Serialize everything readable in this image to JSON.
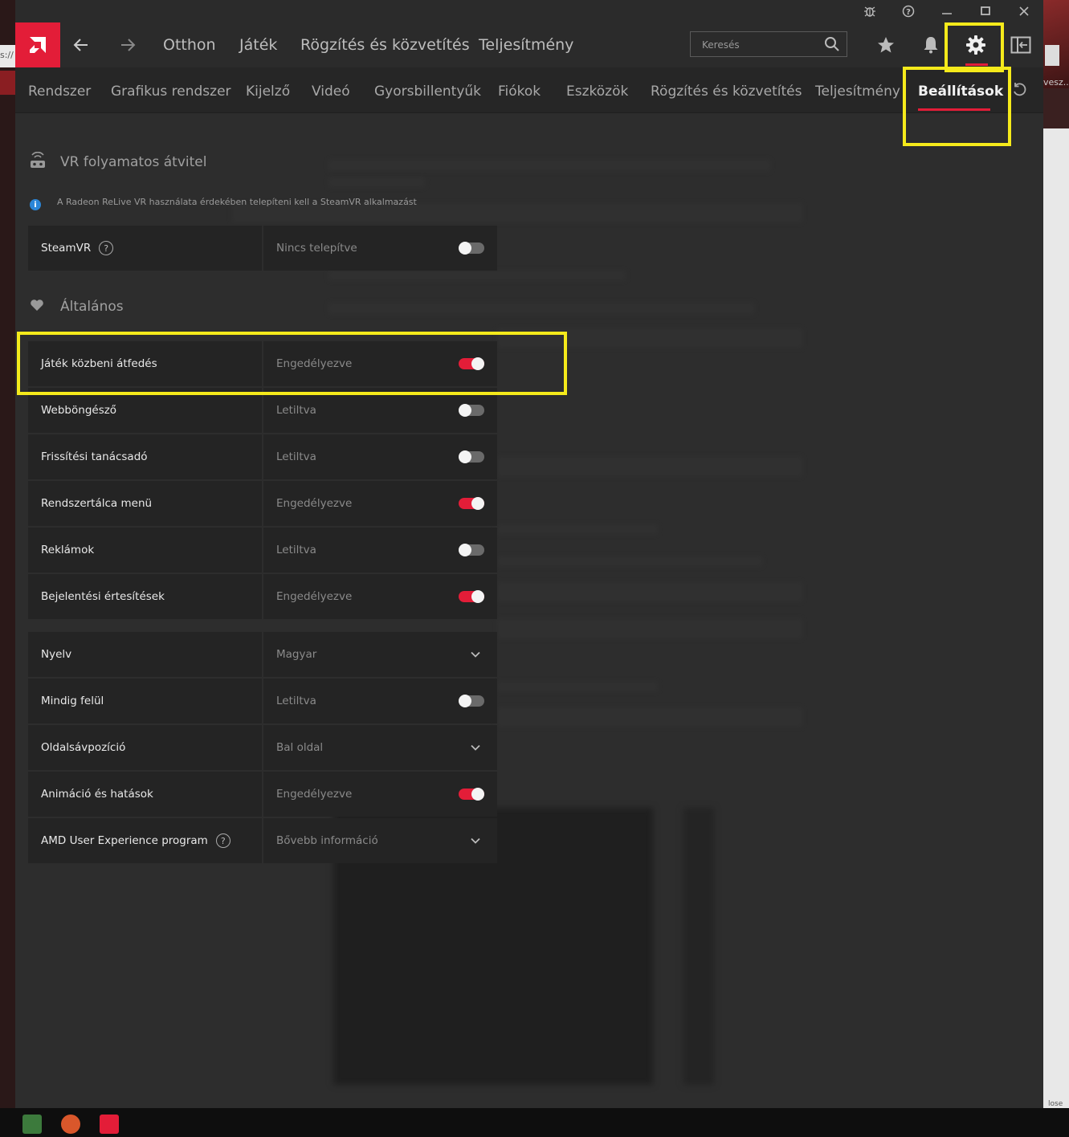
{
  "window": {
    "controls": {
      "bug": "bug-icon",
      "help": "help-icon",
      "minimize": "minimize-icon",
      "maximize": "maximize-icon",
      "close": "close-icon"
    }
  },
  "nav": {
    "back_icon": "back-arrow-icon",
    "forward_icon": "forward-arrow-icon",
    "links": [
      "Otthon",
      "Játék",
      "Rögzítés és közvetítés",
      "Teljesítmény"
    ],
    "search_placeholder": "Keresés"
  },
  "subnav": {
    "tabs": [
      "Rendszer",
      "Grafikus rendszer",
      "Kijelző",
      "Videó",
      "Gyorsbillentyűk",
      "Fiókok",
      "Eszközök",
      "Rögzítés és közvetítés",
      "Teljesítmény",
      "Beállítások"
    ],
    "active_index": 9
  },
  "vr": {
    "title": "VR folyamatos átvitel",
    "info": "A Radeon ReLive VR használata érdekében telepíteni kell a SteamVR alkalmazást",
    "rows": [
      {
        "label": "SteamVR",
        "value": "Nincs telepítve",
        "on": false
      }
    ]
  },
  "general": {
    "title": "Általános",
    "rows": [
      {
        "label": "Játék közbeni átfedés",
        "value": "Engedélyezve",
        "on": true
      },
      {
        "label": "Webböngésző",
        "value": "Letiltva",
        "on": false
      },
      {
        "label": "Frissítési tanácsadó",
        "value": "Letiltva",
        "on": false
      },
      {
        "label": "Rendszertálca menü",
        "value": "Engedélyezve",
        "on": true
      },
      {
        "label": "Reklámok",
        "value": "Letiltva",
        "on": false
      },
      {
        "label": "Bejelentési értesítések",
        "value": "Engedélyezve",
        "on": true
      }
    ]
  },
  "other": {
    "rows": [
      {
        "label": "Nyelv",
        "value": "Magyar",
        "type": "dropdown"
      },
      {
        "label": "Mindig felül",
        "value": "Letiltva",
        "type": "toggle",
        "on": false
      },
      {
        "label": "Oldalsávpozíció",
        "value": "Bal oldal",
        "type": "dropdown"
      },
      {
        "label": "Animáció és hatások",
        "value": "Engedélyezve",
        "type": "toggle",
        "on": true
      },
      {
        "label": "AMD User Experience program",
        "value": "Bővebb információ",
        "type": "dropdown"
      }
    ]
  },
  "desktop": {
    "left_url_fragment": "s://",
    "right_text": "vesz...",
    "right_close": "lose"
  },
  "colors": {
    "accent": "#e31d38",
    "highlight": "#f5ea1b"
  }
}
